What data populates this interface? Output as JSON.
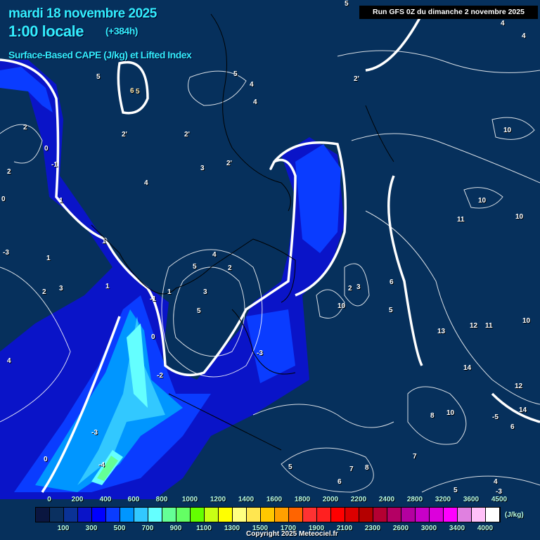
{
  "header": {
    "date": "mardi 18 novembre 2025",
    "hour": "1:00 locale",
    "lead": "(+384h)",
    "parameter": "Surface-Based CAPE (J/kg) et Lifted Index",
    "run": "Run GFS 0Z du dimanche 2 novembre 2025"
  },
  "contour_labels": [
    "5",
    "4",
    "4",
    "5",
    "2'",
    "5",
    "4",
    "4",
    "6",
    "5",
    "2",
    "2'",
    "2'",
    "0",
    "-1",
    "2",
    "1",
    "3",
    "4",
    "2'",
    "0",
    "1",
    "10",
    "10",
    "11",
    "10",
    "-3",
    "1",
    "2",
    "3",
    "4",
    "5",
    "1",
    "1",
    "-1",
    "0",
    "2",
    "5",
    "3",
    "10",
    "3",
    "2",
    "5",
    "6",
    "13",
    "12",
    "11",
    "10",
    "14",
    "4",
    "-2",
    "-3",
    "12",
    "8",
    "10",
    "14",
    "6",
    "-3",
    "-4",
    "0",
    "5",
    "7",
    "6",
    "8",
    "7",
    "5",
    "4",
    "-3",
    "-5"
  ],
  "legend": {
    "colors": [
      "#0a1640",
      "#0a3060",
      "#0a3296",
      "#0a14c8",
      "#0000ff",
      "#0a3cff",
      "#0096ff",
      "#32c8ff",
      "#64ffff",
      "#64ff96",
      "#64ff64",
      "#64ff00",
      "#c8ff14",
      "#ffff00",
      "#ffff80",
      "#ffe650",
      "#ffc800",
      "#ffa000",
      "#ff6400",
      "#ff3232",
      "#ff2020",
      "#ff0000",
      "#dc0000",
      "#b40000",
      "#b40032",
      "#b40064",
      "#b400a0",
      "#c800c8",
      "#dc00dc",
      "#ff00ff",
      "#e080e0",
      "#ffc0f8",
      "#ffffff"
    ],
    "top_ticks": [
      "0",
      "200",
      "400",
      "600",
      "800",
      "1000",
      "1200",
      "1400",
      "1600",
      "1800",
      "2000",
      "2200",
      "2400",
      "2800",
      "3200",
      "3600",
      "4500"
    ],
    "bottom_ticks": [
      "100",
      "300",
      "500",
      "700",
      "900",
      "1100",
      "1300",
      "1500",
      "1700",
      "1900",
      "2100",
      "2300",
      "2600",
      "3000",
      "3400",
      "4000"
    ],
    "unit": "(J/kg)"
  },
  "copyright": "Copyright 2025 Meteociel.fr"
}
